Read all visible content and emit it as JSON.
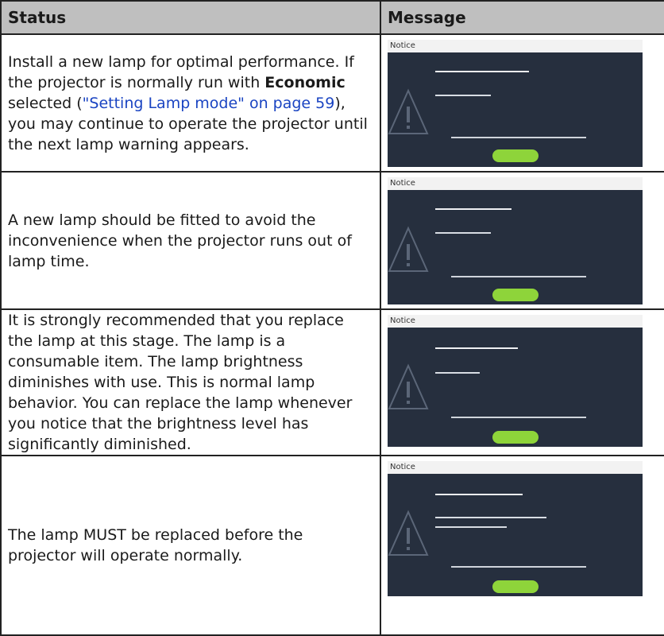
{
  "table": {
    "header_status": "Status",
    "header_message": "Message"
  },
  "rows": [
    {
      "status_part1": "Install a new lamp for optimal performance. If the projector is normally run with ",
      "status_bold": "Economic",
      "status_part2": " selected (",
      "status_link": "\"Setting Lamp mode\" on page 59",
      "status_part3": "), you may continue to operate the projector until the next lamp warning appears."
    },
    {
      "status": "A new lamp should be fitted to avoid the inconvenience when the projector runs out of lamp time."
    },
    {
      "status": "It is strongly recommended that you replace the lamp at this stage. The lamp is a consumable item. The lamp brightness diminishes with use. This is normal lamp behavior. You can replace the lamp whenever you notice that the brightness level has significantly diminished."
    },
    {
      "status": "The lamp MUST be replaced before the projector will operate normally."
    }
  ],
  "osd_colors": {
    "background": "#262f3e",
    "title_bar": "#f2f2f2",
    "ok_button": "#8ed43a"
  }
}
